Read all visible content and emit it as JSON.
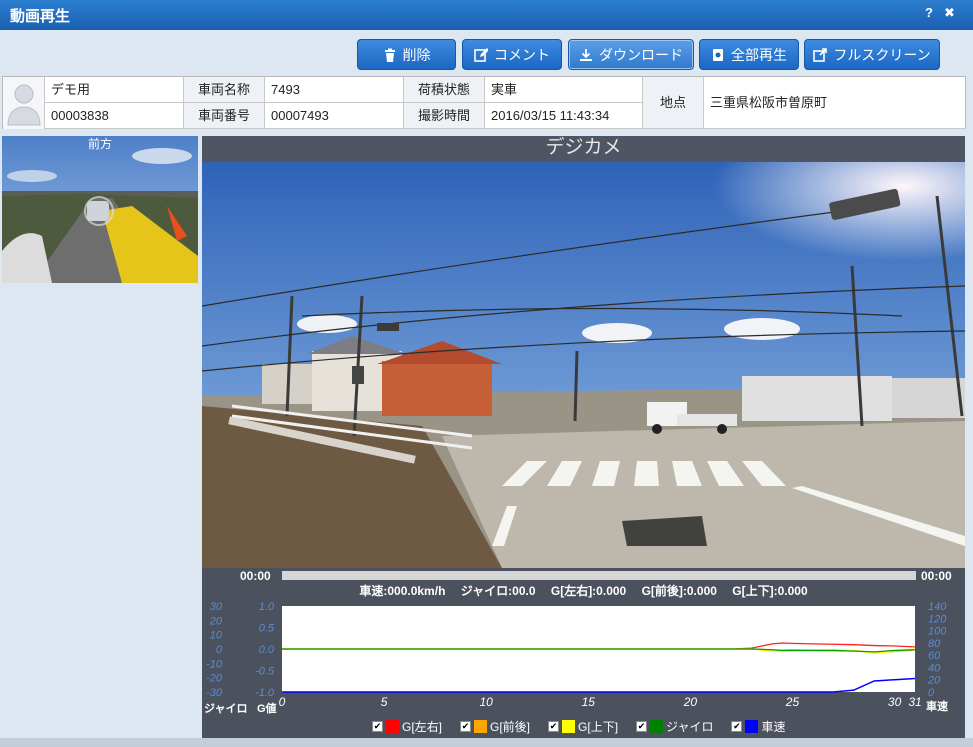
{
  "window": {
    "title": "動画再生",
    "help_icon": "?",
    "close_icon": "✖"
  },
  "toolbar": {
    "delete_label": "削除",
    "comment_label": "コメント",
    "download_label": "ダウンロード",
    "playall_label": "全部再生",
    "fullscreen_label": "フルスクリーン"
  },
  "info": {
    "user": "デモ用",
    "user_id": "00003838",
    "vehicle_name_label": "車両名称",
    "vehicle_name": "7493",
    "vehicle_number_label": "車両番号",
    "vehicle_number": "00007493",
    "load_status_label": "荷積状態",
    "load_status": "実車",
    "shot_time_label": "撮影時間",
    "shot_time": "2016/03/15 11:43:34",
    "location_label": "地点",
    "location": "三重県松阪市曽原町"
  },
  "thumbnail": {
    "label": "前方"
  },
  "video": {
    "title": "デジカメ"
  },
  "playback": {
    "current_time": "00:00",
    "total_time": "00:00",
    "progress": 0,
    "speed": "車速:000.0km/h",
    "gyro": "ジャイロ:00.0",
    "g_lr": "G[左右]:0.000",
    "g_fb": "G[前後]:0.000",
    "g_ud": "G[上下]:0.000"
  },
  "chart_data": {
    "type": "line",
    "x": [
      0,
      2,
      4,
      6,
      8,
      10,
      12,
      14,
      16,
      18,
      20,
      22,
      23,
      24,
      24.5,
      25,
      26,
      27,
      28,
      29,
      30,
      31
    ],
    "xticks": [
      "0",
      "5",
      "10",
      "15",
      "20",
      "25",
      "30",
      "31"
    ],
    "xlim": [
      0,
      31
    ],
    "left_axis1": {
      "label": "ジャイロ",
      "ticks": [
        "30",
        "20",
        "10",
        "0",
        "-10",
        "-20",
        "-30"
      ],
      "range": [
        -30,
        30
      ]
    },
    "left_axis2": {
      "label": "G値",
      "ticks": [
        "1.0",
        "0.5",
        "0.0",
        "-0.5",
        "-1.0"
      ],
      "range": [
        -1.0,
        1.0
      ]
    },
    "right_axis": {
      "label": "車速",
      "ticks": [
        "140",
        "120",
        "100",
        "80",
        "60",
        "40",
        "20",
        "0"
      ],
      "range": [
        0,
        140
      ]
    },
    "series": [
      {
        "name": "G[左右]",
        "color": "#ff2020",
        "axis": "g",
        "values": [
          0,
          0,
          0,
          0,
          0,
          0,
          0,
          0,
          0,
          0,
          0,
          0,
          0.02,
          0.12,
          0.14,
          0.13,
          0.12,
          0.11,
          0.1,
          0.08,
          0.07,
          0.05
        ]
      },
      {
        "name": "G[前後]",
        "color": "#ffa500",
        "axis": "g",
        "values": [
          0,
          0,
          0,
          0,
          0,
          0,
          0,
          0,
          0,
          0,
          0,
          0,
          0,
          -0.02,
          -0.03,
          -0.02,
          -0.03,
          -0.03,
          -0.04,
          -0.08,
          -0.06,
          -0.02
        ]
      },
      {
        "name": "G[上下]",
        "color": "#ffff00",
        "axis": "g",
        "values": [
          0,
          0,
          0,
          0,
          0,
          0,
          0,
          0,
          0,
          0,
          0,
          0,
          0,
          -0.05,
          -0.06,
          -0.04,
          -0.05,
          -0.06,
          -0.03,
          -0.1,
          -0.05,
          0.0
        ]
      },
      {
        "name": "ジャイロ",
        "color": "#00a000",
        "axis": "gyro",
        "values": [
          0,
          0,
          0,
          0,
          0,
          0,
          0,
          0,
          0,
          0,
          0,
          0,
          0,
          -0.5,
          -1,
          -1,
          -1,
          -1,
          -1.5,
          -2,
          -1,
          -0.5
        ]
      },
      {
        "name": "車速",
        "color": "#0000ff",
        "axis": "speed",
        "values": [
          0,
          0,
          0,
          0,
          0,
          0,
          0,
          0,
          0,
          0,
          0,
          0,
          0,
          0,
          0,
          0,
          0,
          0,
          3,
          18,
          20,
          22
        ]
      }
    ]
  },
  "legend": [
    {
      "name": "G[左右]",
      "color": "#ff0000"
    },
    {
      "name": "G[前後]",
      "color": "#ffa500"
    },
    {
      "name": "G[上下]",
      "color": "#ffff00"
    },
    {
      "name": "ジャイロ",
      "color": "#008000"
    },
    {
      "name": "車速",
      "color": "#0000ff"
    }
  ]
}
